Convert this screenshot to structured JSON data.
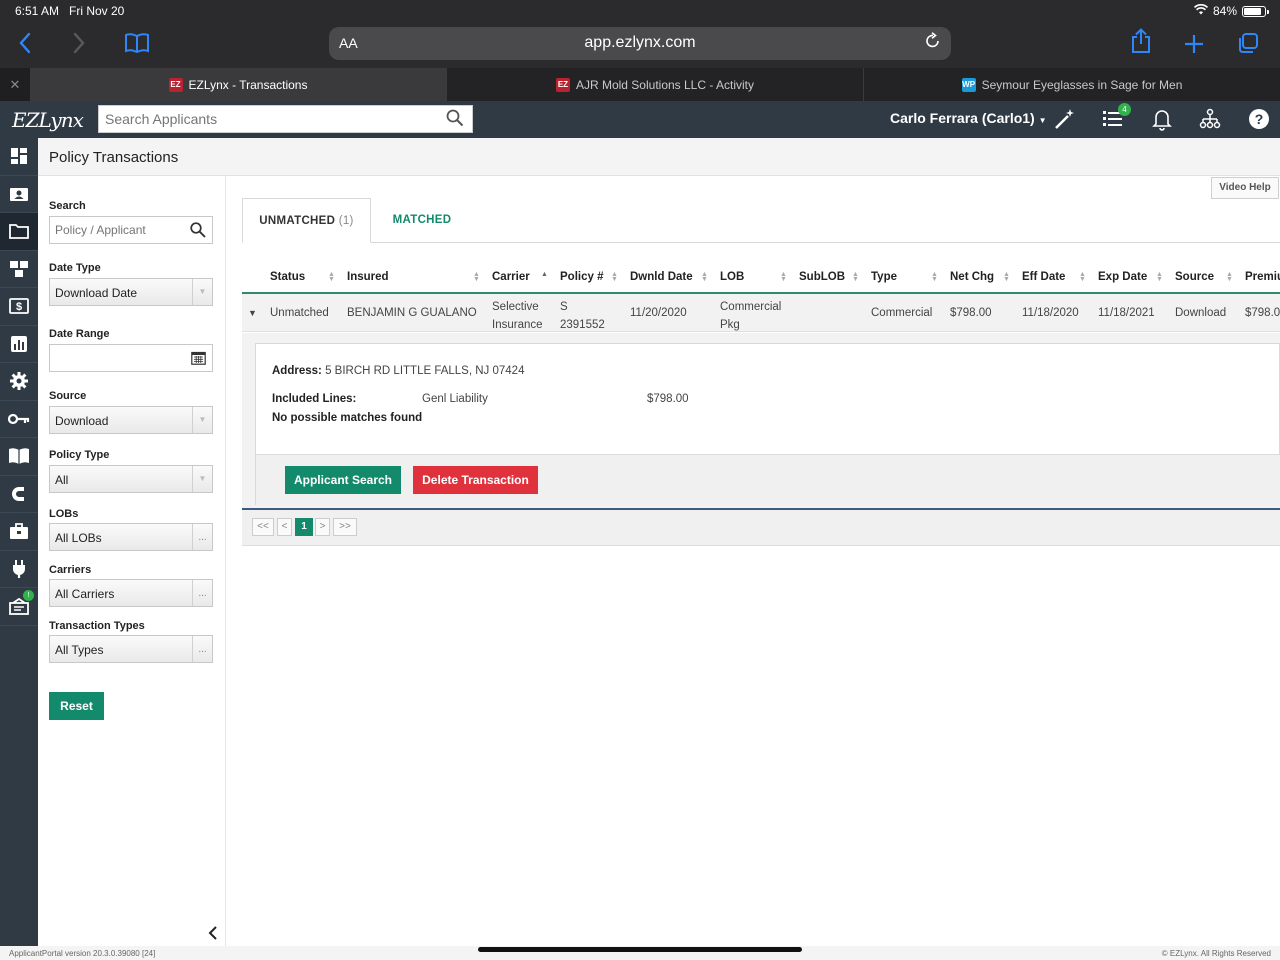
{
  "ios": {
    "time": "6:51 AM",
    "date": "Fri Nov 20",
    "battery": "84%",
    "battery_level": 0.84
  },
  "browser": {
    "aa": "AA",
    "url": "app.ezlynx.com",
    "tabs": [
      {
        "title": "EZLynx - Transactions",
        "favicon": "EZ",
        "active": true
      },
      {
        "title": "AJR Mold Solutions LLC - Activity",
        "favicon": "EZ",
        "active": false
      },
      {
        "title": "Seymour Eyeglasses in Sage for Men",
        "favicon": "WP",
        "active": false
      }
    ]
  },
  "header": {
    "logo": "EZLynx",
    "search_placeholder": "Search Applicants",
    "user": "Carlo Ferrara (Carlo1)",
    "notification_count": "4"
  },
  "rail": {
    "badge": "!"
  },
  "page": {
    "title": "Policy Transactions"
  },
  "filters": {
    "search_label": "Search",
    "search_placeholder": "Policy / Applicant",
    "date_type_label": "Date Type",
    "date_type_value": "Download Date",
    "date_range_label": "Date Range",
    "source_label": "Source",
    "source_value": "Download",
    "policy_type_label": "Policy Type",
    "policy_type_value": "All",
    "lobs_label": "LOBs",
    "lobs_value": "All LOBs",
    "carriers_label": "Carriers",
    "carriers_value": "All Carriers",
    "transaction_types_label": "Transaction Types",
    "transaction_types_value": "All Types",
    "reset_label": "Reset"
  },
  "main": {
    "video_help": "Video Help",
    "tabs": {
      "unmatched": "UNMATCHED",
      "unmatched_count": "(1)",
      "matched": "MATCHED"
    },
    "columns": [
      "Status",
      "Insured",
      "Carrier",
      "Policy #",
      "Dwnld Date",
      "LOB",
      "SubLOB",
      "Type",
      "Net Chg",
      "Eff Date",
      "Exp Date",
      "Source",
      "Premiu"
    ],
    "row": {
      "status": "Unmatched",
      "insured": "BENJAMIN G GUALANO",
      "carrier_1": "Selective",
      "carrier_2": "Insurance",
      "policy_1": "S",
      "policy_2": "2391552",
      "dwnld_date": "11/20/2020",
      "lob_1": "Commercial",
      "lob_2": "Pkg",
      "sublob": "",
      "type": "Commercial",
      "net_chg": "$798.00",
      "eff_date": "11/18/2020",
      "exp_date": "11/18/2021",
      "source": "Download",
      "premium": "$798.0"
    },
    "detail": {
      "address_label": "Address:",
      "address": "5 BIRCH RD LITTLE FALLS, NJ 07424",
      "included_label": "Included Lines:",
      "line_name": "Genl Liability",
      "line_amount": "$798.00",
      "no_matches": "No possible matches found",
      "applicant_search": "Applicant Search",
      "delete_transaction": "Delete Transaction"
    },
    "pager": {
      "first": "<<",
      "prev": "<",
      "current": "1",
      "next": ">",
      "last": ">>"
    }
  },
  "footer": {
    "version": "ApplicantPortal version 20.3.0.39080 [24]",
    "copyright": "© EZLynx. All Rights Reserved"
  }
}
